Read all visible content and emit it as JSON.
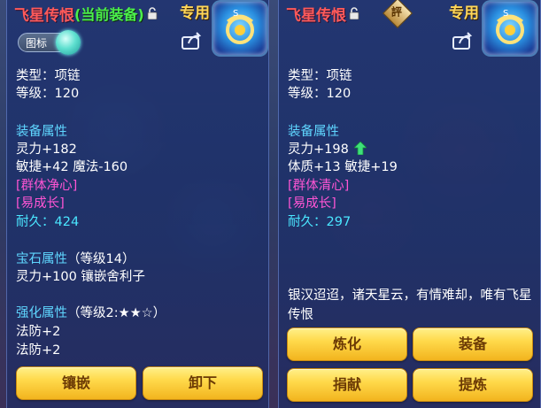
{
  "left_panel": {
    "item_name": "飞星传恨",
    "equipped_tag": "(当前装备)",
    "exclusive": "专用",
    "toggle_label": "图标",
    "type_line": "类型：项链",
    "level_line": "等级：120",
    "equip_attr_header": "装备属性",
    "attr_line1": "灵力+182",
    "attr_line2": "敏捷+42 魔法-160",
    "special_effect": "[群体净心]",
    "special_skill": "[易成长]",
    "durability_label": "耐久：",
    "durability_value": "424",
    "gem_header": "宝石属性",
    "gem_level": "（等级14）",
    "gem_line": "灵力+100 镶嵌舍利子",
    "strengthen_header": "强化属性",
    "strengthen_level": "（等级2:★★☆）",
    "strengthen_line1": "法防+2",
    "strengthen_line2": "法防+2",
    "buttons": {
      "inlay": "镶嵌",
      "unequip": "卸下"
    }
  },
  "right_panel": {
    "item_name": "飞星传恨",
    "badge": "評",
    "exclusive": "专用",
    "type_line": "类型：项链",
    "level_line": "等级：120",
    "equip_attr_header": "装备属性",
    "attr_line1": "灵力+198",
    "attr_line2": "体质+13 敏捷+19",
    "special_effect": "[群体清心]",
    "special_skill": "[易成长]",
    "durability_label": "耐久：",
    "durability_value": "297",
    "description": "银汉迢迢，诸天星云，有情难却，唯有飞星传恨",
    "buttons": {
      "refine": "炼化",
      "equip": "装备",
      "donate": "捐献",
      "extract": "提炼"
    }
  },
  "colors": {
    "name_red": "#ff5a5a",
    "equipped_green": "#4bf04b",
    "exclusive_gold": "#ffd75a",
    "header_blue": "#5fd6ff",
    "special_magenta": "#ff55d4",
    "durability_cyan": "#4ae6ff",
    "button_gold": "#ffd94a"
  },
  "icons": [
    "lock-icon",
    "treasure-icon",
    "share-icon",
    "toggle-knob",
    "up-arrow-icon"
  ]
}
